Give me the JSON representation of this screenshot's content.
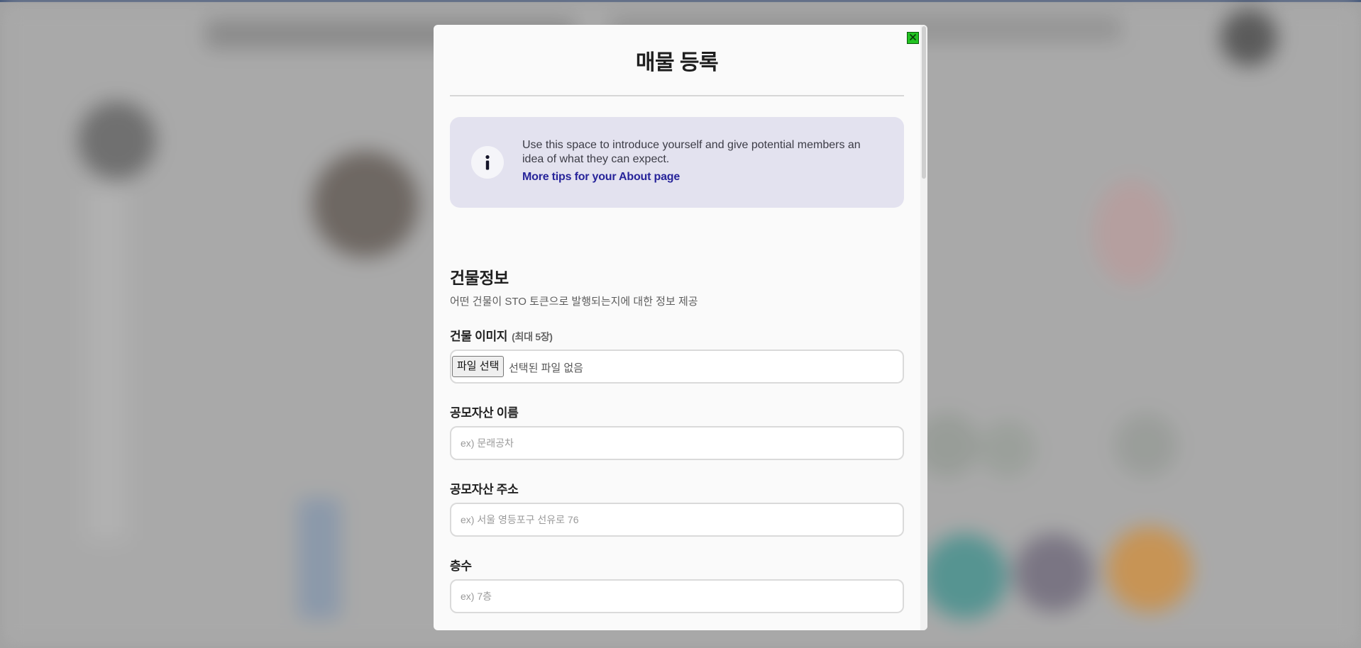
{
  "modal": {
    "title": "매물 등록",
    "close_icon": "close-icon",
    "info": {
      "icon": "info-icon",
      "text": "Use this space to introduce yourself and give potential members an idea of what they can expect.",
      "link": "More tips for your About page"
    },
    "section": {
      "title": "건물정보",
      "description": "어떤 건물이 STO 토큰으로 발행되는지에 대한 정보 제공"
    },
    "fields": {
      "image": {
        "label": "건물 이미지",
        "sub_label": "(최대 5장)",
        "button": "파일 선택",
        "status": "선택된 파일 없음"
      },
      "name": {
        "label": "공모자산 이름",
        "placeholder": "ex) 문래공차"
      },
      "address": {
        "label": "공모자산 주소",
        "placeholder": "ex) 서울 영등포구 선유로 76"
      },
      "floors": {
        "label": "층수",
        "placeholder": "ex) 7층"
      }
    }
  },
  "colors": {
    "accent_link": "#27249a",
    "info_bg": "#e3e2ef",
    "close_button": "#22c322",
    "top_line": "#1e3a6e"
  }
}
